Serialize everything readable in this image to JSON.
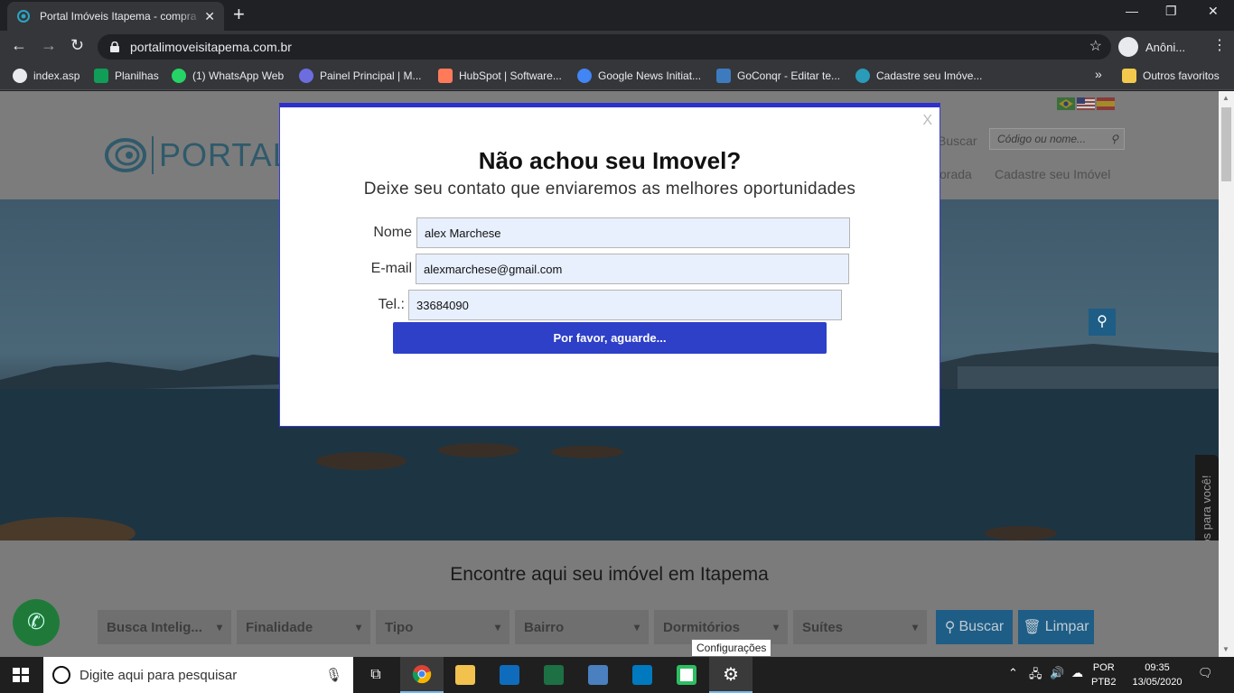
{
  "browser": {
    "tab_title": "Portal Imóveis Itapema - compra",
    "url": "portalimoveisitapema.com.br",
    "profile_label": "Anôni...",
    "bookmarks": [
      {
        "label": "index.asp",
        "color": "#e8eaed"
      },
      {
        "label": "Planilhas",
        "color": "#0f9d58"
      },
      {
        "label": "(1) WhatsApp Web",
        "color": "#25d366"
      },
      {
        "label": "Painel Principal | M...",
        "color": "#6d6de0"
      },
      {
        "label": "HubSpot | Software...",
        "color": "#ff7a59"
      },
      {
        "label": "Google News Initiat...",
        "color": "#4285f4"
      },
      {
        "label": "GoConqr - Editar te...",
        "color": "#3d7bbf"
      },
      {
        "label": "Cadastre seu Imóve...",
        "color": "#2a9bb8"
      }
    ],
    "bookmarks_overflow": "»",
    "other_bookmarks": "Outros favoritos"
  },
  "site": {
    "logo_text": "PORTALIM",
    "header_search_placeholder": "Código ou nome...",
    "header_search_label": "Buscar",
    "menu_item_1": "orada",
    "menu_item_2": "Cadastre seu Imóvel",
    "side_tab": "Ligamos para você!",
    "find_title": "Encontre aqui seu imóvel em Itapema",
    "filters": [
      "Busca Intelig...",
      "Finalidade",
      "Tipo",
      "Bairro",
      "Dormitórios",
      "Suítes"
    ],
    "search_button": "Buscar",
    "clear_button": "Limpar"
  },
  "modal": {
    "close_label": "X",
    "title": "Não achou seu Imovel?",
    "subtitle": "Deixe seu contato que enviaremos as melhores oportunidades",
    "name_label": "Nome",
    "name_value": "alex Marchese",
    "email_label": "E-mail",
    "email_value": "alexmarchese@gmail.com",
    "phone_label": "Tel.:",
    "phone_value": "33684090",
    "submit_label": "Por favor, aguarde..."
  },
  "tooltip": "Configurações",
  "taskbar": {
    "search_placeholder": "Digite aqui para pesquisar",
    "lang_line1": "POR",
    "lang_line2": "PTB2",
    "time": "09:35",
    "date": "13/05/2020"
  },
  "colors": {
    "accent_blue": "#2e3fc8",
    "modal_border": "#2f2fcc",
    "site_blue": "#1e5d86"
  }
}
